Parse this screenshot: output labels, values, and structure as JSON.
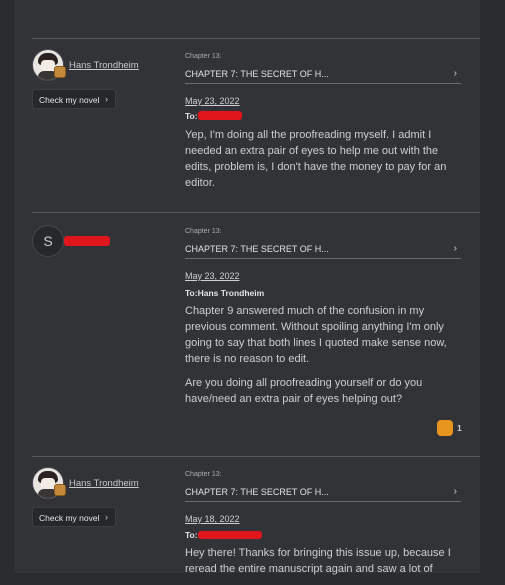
{
  "comments": [
    {
      "username": "Hans Trondheim",
      "novel_button": "Check my novel",
      "chapter_label": "Chapter 13:",
      "chapter_title": "CHAPTER 7: THE SECRET OF H...",
      "date": "May 23, 2022",
      "to_label": "To:",
      "paragraphs": [
        "Yep, I'm doing all the proofreading myself. I admit I needed an extra pair of eyes to help me out with the edits, problem is, I don't have the money to pay for an editor."
      ]
    },
    {
      "avatar_letter": "S",
      "chapter_label": "Chapter 13:",
      "chapter_title": "CHAPTER 7: THE SECRET OF H...",
      "date": "May 23, 2022",
      "to_label": "To:Hans Trondheim",
      "paragraphs": [
        "Chapter 9 answered much of the confusion in my previous comment. Without spoiling anything I'm only going to say that both lines I quoted make sense now, there is no reason to edit.",
        "Are you doing all proofreading yourself or do you have/need an extra pair of eyes helping out?"
      ],
      "likes": "1"
    },
    {
      "username": "Hans Trondheim",
      "novel_button": "Check my novel",
      "chapter_label": "Chapter 13:",
      "chapter_title": "CHAPTER 7: THE SECRET OF H...",
      "date": "May 18, 2022",
      "to_label": "To:",
      "paragraphs": [
        "Hey there! Thanks for bringing this issue up, because I reread the entire manuscript again and saw a lot of"
      ]
    }
  ],
  "icons": {
    "chevron": "chevron-right-icon",
    "like": "like-badge-icon"
  },
  "colors": {
    "redaction": "#e0161c",
    "like_badge": "#e8951f"
  }
}
